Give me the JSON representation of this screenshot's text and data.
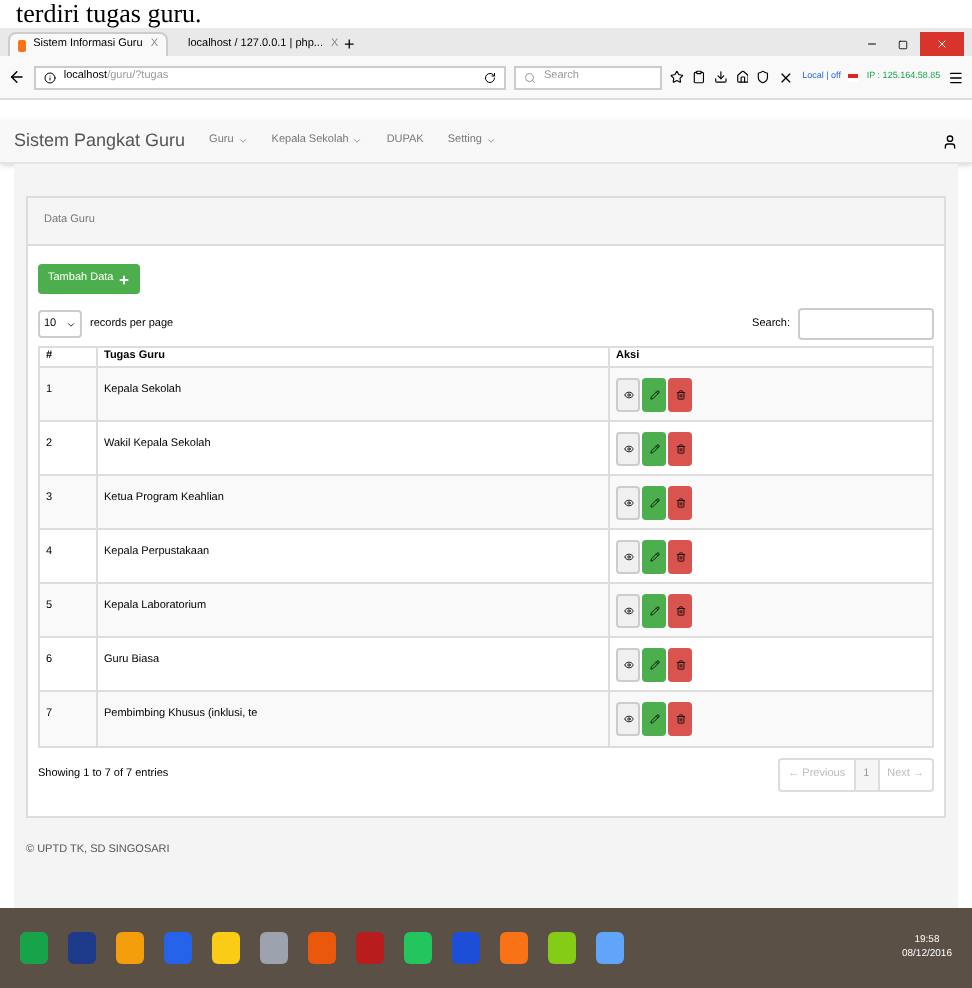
{
  "document_text": "terdiri tugas guru.",
  "browser": {
    "tabs": [
      {
        "label": "Sistem Informasi Guru",
        "close": "X",
        "selected": true
      },
      {
        "label": "localhost / 127.0.0.1 | php...",
        "close": "X",
        "selected": false
      }
    ],
    "new_tab": "+",
    "url_host": "localhost",
    "url_path": "/guru/?tugas",
    "search_placeholder": "Search",
    "addon_text": "Local | off",
    "ip_text": "IP : 125.164.58.85"
  },
  "navbar": {
    "brand": "Sistem Pangkat Guru",
    "items": [
      {
        "label": "Guru",
        "dropdown": true
      },
      {
        "label": "Kepala Sekolah",
        "dropdown": true
      },
      {
        "label": "DUPAK",
        "dropdown": false
      },
      {
        "label": "Setting",
        "dropdown": true
      }
    ]
  },
  "panel": {
    "title": "Data Guru",
    "add_button": "Tambah Data",
    "page_size": "10",
    "page_size_label": "records per page",
    "search_label": "Search:",
    "columns": [
      "#",
      "Tugas Guru",
      "Aksi"
    ],
    "rows": [
      {
        "no": "1",
        "tugas": "Kepala Sekolah"
      },
      {
        "no": "2",
        "tugas": "Wakil Kepala Sekolah"
      },
      {
        "no": "3",
        "tugas": "Ketua Program Keahlian"
      },
      {
        "no": "4",
        "tugas": "Kepala Perpustakaan"
      },
      {
        "no": "5",
        "tugas": "Kepala Laboratorium"
      },
      {
        "no": "6",
        "tugas": "Guru Biasa"
      },
      {
        "no": "7",
        "tugas": "Pembimbing Khusus (inklusi, te"
      }
    ],
    "info": "Showing 1 to 7 of 7 entries",
    "pagination": [
      {
        "label": "← Previous",
        "selected": false
      },
      {
        "label": "1",
        "selected": true
      },
      {
        "label": "Next →",
        "selected": false
      }
    ]
  },
  "footer": "© UPTD TK, SD SINGOSARI",
  "taskbar": {
    "time": "19:58",
    "date": "08/12/2016"
  }
}
